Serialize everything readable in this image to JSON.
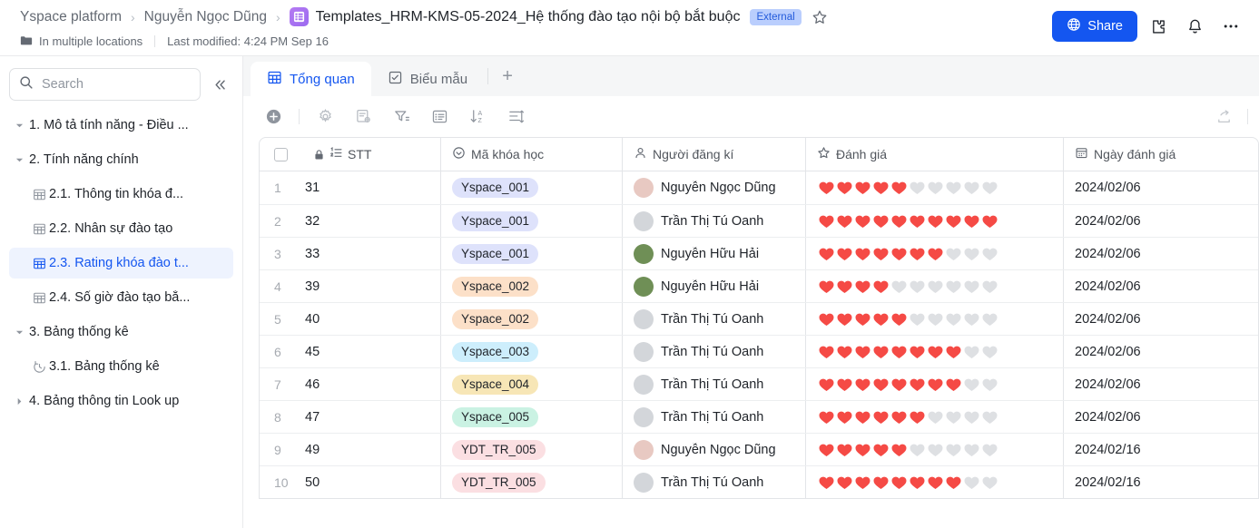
{
  "header": {
    "breadcrumb": [
      {
        "label": "Yspace platform",
        "icon": "none"
      },
      {
        "label": "Nguyễn Ngọc Dũng",
        "icon": "none"
      }
    ],
    "separator": "›",
    "doc_icon": "grid-doc-icon",
    "title": "Templates_HRM-KMS-05-2024_Hệ thống đào tạo nội bộ bắt buộc",
    "badge": "External",
    "star_icon": "star-outline-icon",
    "location_icon": "folder-icon",
    "location_text": "In multiple locations",
    "last_modified": "Last modified: 4:24 PM Sep 16",
    "share_label": "Share",
    "share_icon": "globe-icon",
    "share_color": "#1456f0",
    "badge_bg": "#bacefd",
    "badge_fg": "#245bdb",
    "actions": [
      {
        "name": "puzzle-icon"
      },
      {
        "name": "bell-icon"
      },
      {
        "name": "more-horizontal-icon"
      }
    ]
  },
  "sidebar": {
    "search": {
      "placeholder": "Search",
      "value": "",
      "icon": "search-icon"
    },
    "collapse_icon": "double-chevron-left-icon",
    "items": [
      {
        "label": "1. Mô tả tính năng - Điều ...",
        "level": 0,
        "caret": "down",
        "icon": "none",
        "selected": false
      },
      {
        "label": "2. Tính năng chính",
        "level": 0,
        "caret": "down",
        "icon": "none",
        "selected": false
      },
      {
        "label": "2.1. Thông tin khóa đ...",
        "level": 1,
        "caret": "none",
        "icon": "table-icon",
        "selected": false
      },
      {
        "label": "2.2. Nhân sự đào tạo",
        "level": 1,
        "caret": "none",
        "icon": "table-icon",
        "selected": false
      },
      {
        "label": "2.3. Rating khóa đào t...",
        "level": 1,
        "caret": "none",
        "icon": "table-icon",
        "selected": true
      },
      {
        "label": "2.4. Số giờ đào tạo bắ...",
        "level": 1,
        "caret": "none",
        "icon": "table-icon",
        "selected": false
      },
      {
        "label": "3. Bảng thống kê",
        "level": 0,
        "caret": "down",
        "icon": "none",
        "selected": false
      },
      {
        "label": "3.1. Bảng thống kê",
        "level": 1,
        "caret": "none",
        "icon": "clock-icon",
        "selected": false
      },
      {
        "label": "4. Bảng thông tin Look up",
        "level": 0,
        "caret": "right",
        "icon": "none",
        "selected": false
      }
    ],
    "selected_color": "#1456f0"
  },
  "tabs": {
    "items": [
      {
        "label": "Tổng quan",
        "icon": "grid-table-icon",
        "active": true
      },
      {
        "label": "Biểu mẫu",
        "icon": "form-checkbox-icon",
        "active": false
      }
    ],
    "add_label": "+"
  },
  "toolbar": {
    "buttons": [
      {
        "name": "add-record-button",
        "icon": "plus-circle-icon"
      },
      {
        "name": "settings-button",
        "icon": "gear-icon"
      },
      {
        "name": "field-config-button",
        "icon": "field-settings-icon"
      },
      {
        "name": "filter-button",
        "icon": "filter-icon"
      },
      {
        "name": "group-button",
        "icon": "list-view-icon"
      },
      {
        "name": "sort-button",
        "icon": "sort-az-icon"
      },
      {
        "name": "row-height-button",
        "icon": "row-height-icon"
      }
    ],
    "export_icon": "share-export-icon"
  },
  "table": {
    "columns": [
      {
        "key": "stt",
        "label": "STT",
        "icon": "number-list-icon",
        "lock": true,
        "checkbox": true
      },
      {
        "key": "code",
        "label": "Mã khóa học",
        "icon": "single-select-icon"
      },
      {
        "key": "user",
        "label": "Người đăng kí",
        "icon": "person-icon"
      },
      {
        "key": "rating",
        "label": "Đánh giá",
        "icon": "star-icon"
      },
      {
        "key": "date",
        "label": "Ngày đánh giá",
        "icon": "calendar-icon"
      }
    ],
    "rating_max": 10,
    "heart_on_color": "#f54a45",
    "heart_off_color": "#dee0e3",
    "tag_colors": {
      "Yspace_001": "#dee2fb",
      "Yspace_002": "#fce0c8",
      "Yspace_003": "#cdeefc",
      "Yspace_004": "#f7e6b6",
      "Yspace_005": "#caf2e3",
      "YDT_TR_005": "#fbdfe2"
    },
    "rows": [
      {
        "n": "1",
        "stt": "31",
        "code": "Yspace_001",
        "user": "Nguyễn Ngọc Dũng",
        "avatar": "#e8c9c2",
        "rating": 5,
        "date": "2024/02/06"
      },
      {
        "n": "2",
        "stt": "32",
        "code": "Yspace_001",
        "user": "Trần Thị Tú Oanh",
        "avatar": "#d3d6da",
        "rating": 10,
        "date": "2024/02/06"
      },
      {
        "n": "3",
        "stt": "33",
        "code": "Yspace_001",
        "user": "Nguyễn Hữu Hải",
        "avatar": "#6f8f56",
        "rating": 7,
        "date": "2024/02/06"
      },
      {
        "n": "4",
        "stt": "39",
        "code": "Yspace_002",
        "user": "Nguyễn Hữu Hải",
        "avatar": "#6f8f56",
        "rating": 4,
        "date": "2024/02/06"
      },
      {
        "n": "5",
        "stt": "40",
        "code": "Yspace_002",
        "user": "Trần Thị Tú Oanh",
        "avatar": "#d3d6da",
        "rating": 5,
        "date": "2024/02/06"
      },
      {
        "n": "6",
        "stt": "45",
        "code": "Yspace_003",
        "user": "Trần Thị Tú Oanh",
        "avatar": "#d3d6da",
        "rating": 8,
        "date": "2024/02/06"
      },
      {
        "n": "7",
        "stt": "46",
        "code": "Yspace_004",
        "user": "Trần Thị Tú Oanh",
        "avatar": "#d3d6da",
        "rating": 8,
        "date": "2024/02/06"
      },
      {
        "n": "8",
        "stt": "47",
        "code": "Yspace_005",
        "user": "Trần Thị Tú Oanh",
        "avatar": "#d3d6da",
        "rating": 6,
        "date": "2024/02/06"
      },
      {
        "n": "9",
        "stt": "49",
        "code": "YDT_TR_005",
        "user": "Nguyễn Ngọc Dũng",
        "avatar": "#e8c9c2",
        "rating": 5,
        "date": "2024/02/16"
      },
      {
        "n": "10",
        "stt": "50",
        "code": "YDT_TR_005",
        "user": "Trần Thị Tú Oanh",
        "avatar": "#d3d6da",
        "rating": 8,
        "date": "2024/02/16"
      }
    ]
  }
}
